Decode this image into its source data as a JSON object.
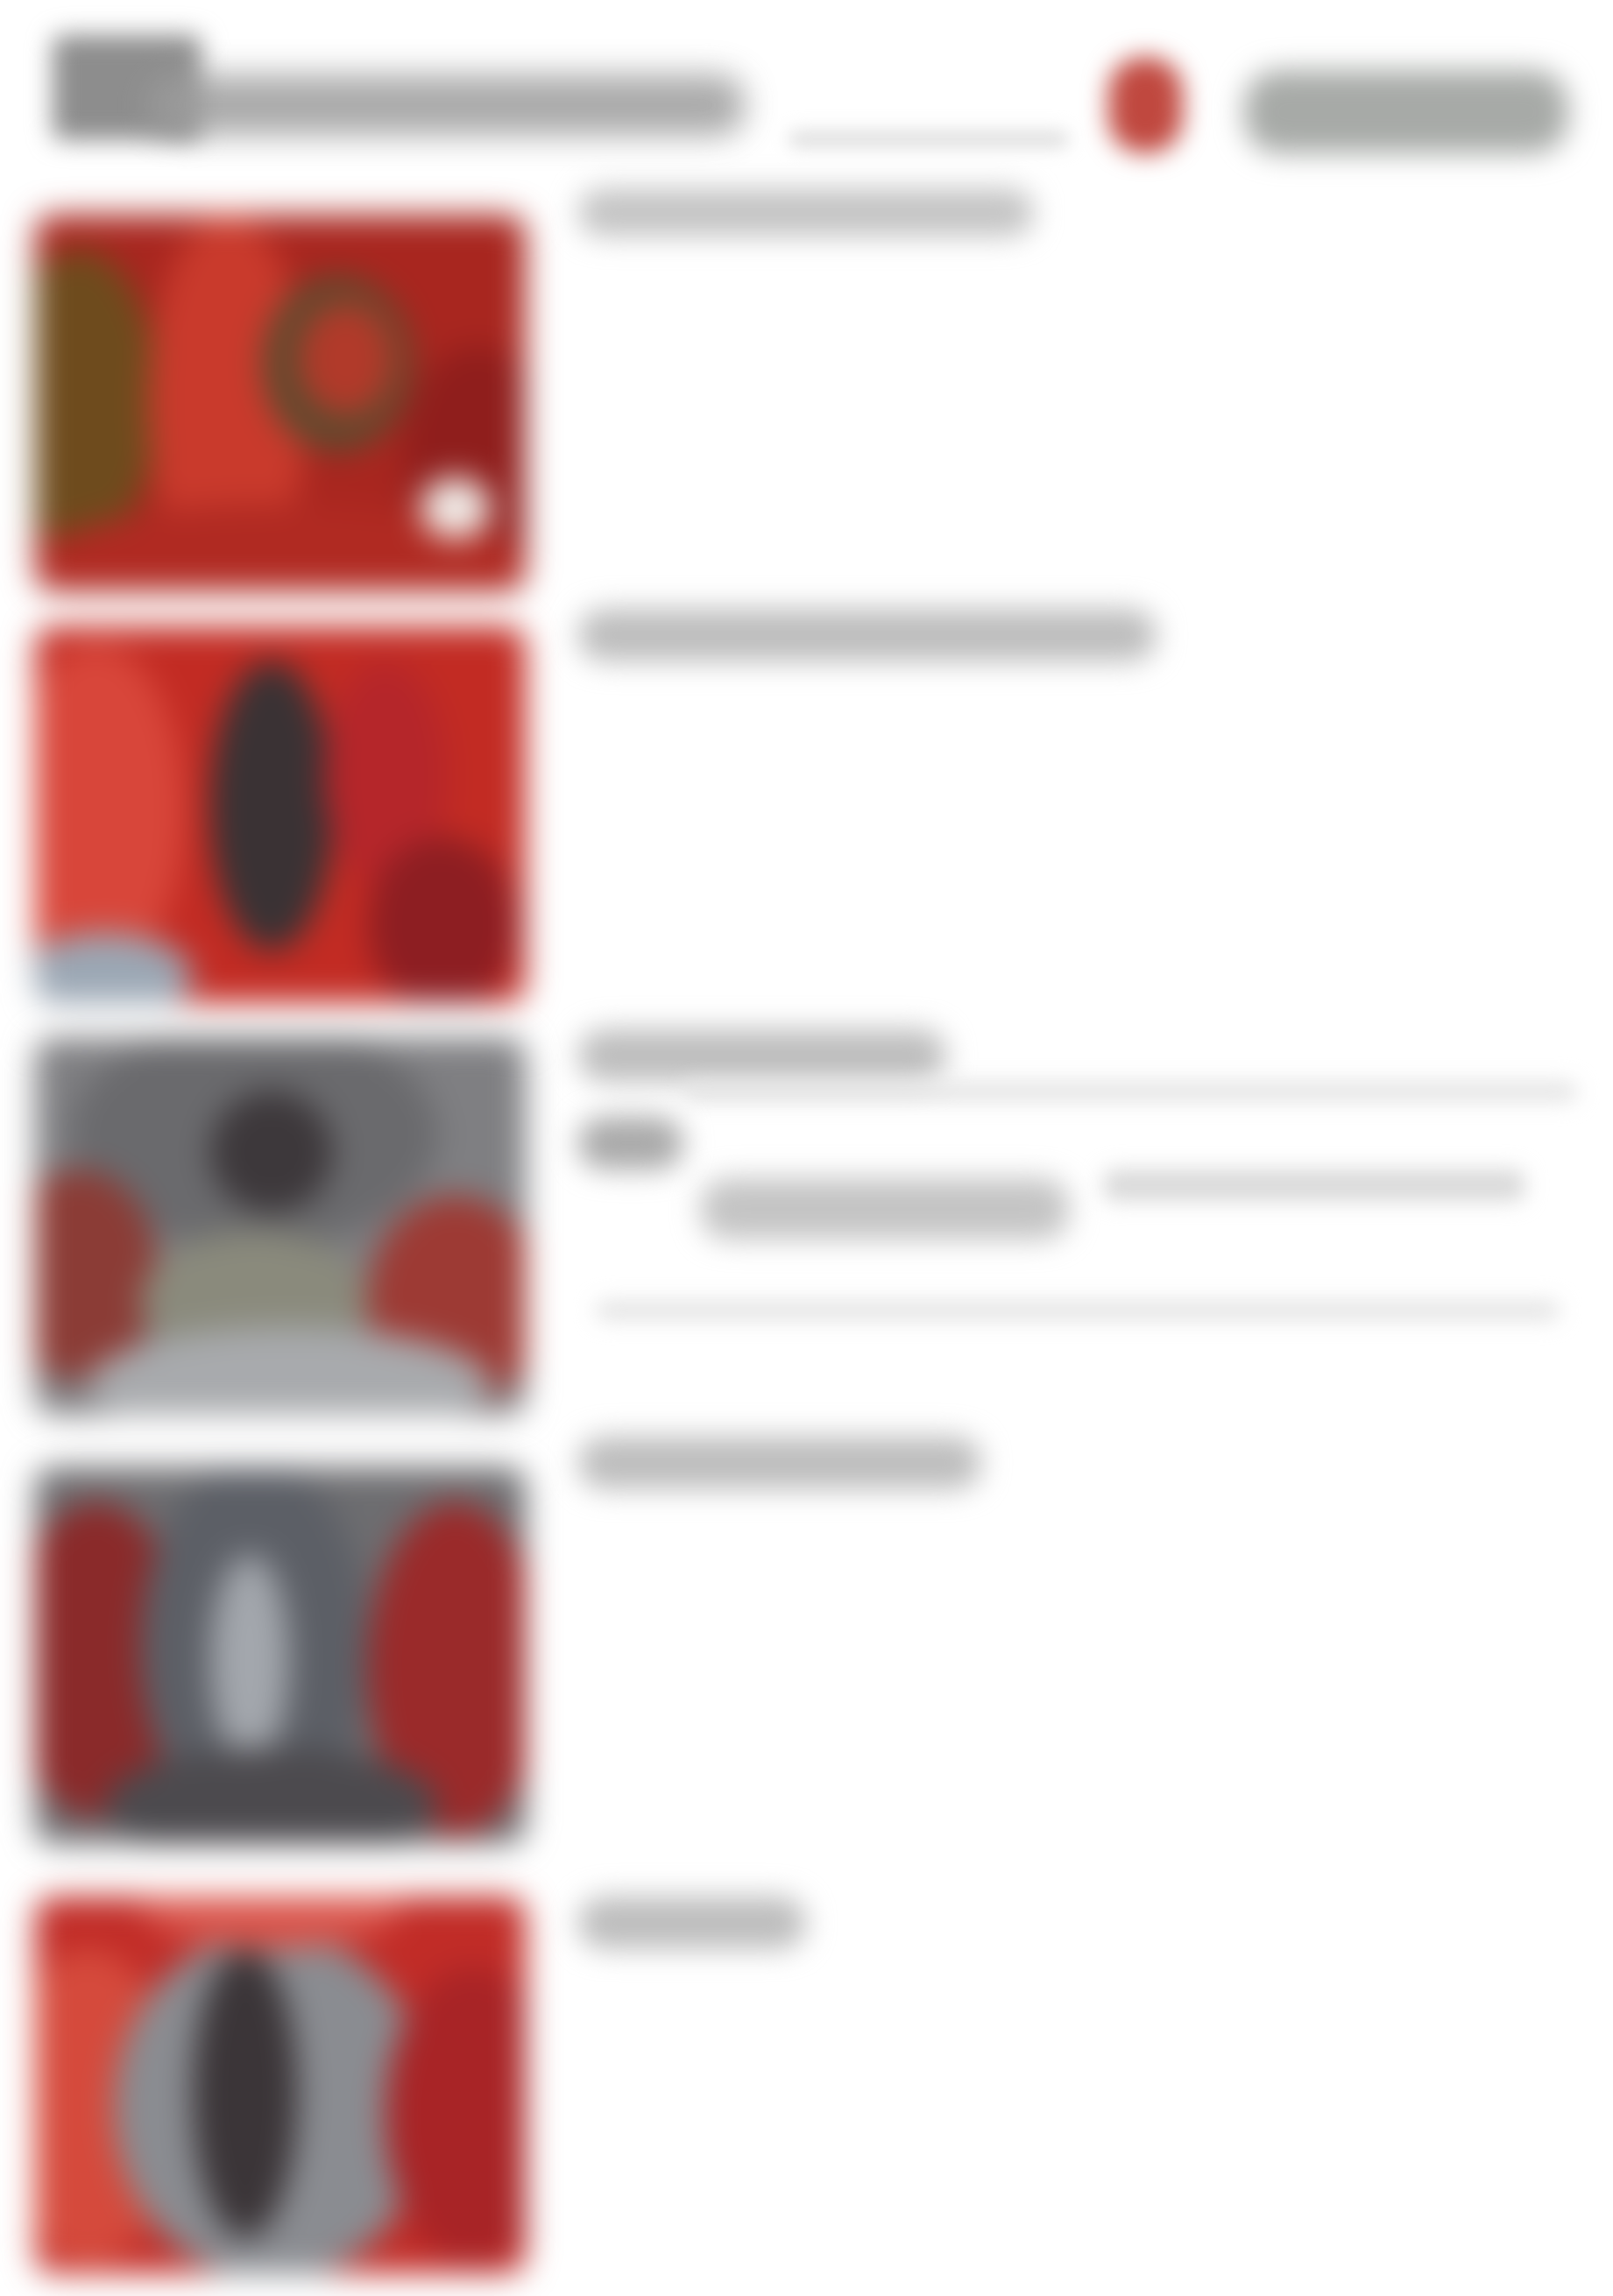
{
  "header": {
    "title": "",
    "subtitle": "",
    "action_label": ""
  },
  "colors": {
    "accent_red": "#b3282c",
    "thumb_gray": "#6f6f72",
    "text_placeholder": "#bdbdbd"
  },
  "items": [
    {
      "label": "",
      "thumbnail": "red-brown-image"
    },
    {
      "label": "",
      "thumbnail": "red-figure-image"
    },
    {
      "label": "",
      "thumbnail": "gray-cluster-image"
    },
    {
      "label": "",
      "thumbnail": "gray-red-image"
    },
    {
      "label": "",
      "thumbnail": "red-gray-image"
    }
  ]
}
